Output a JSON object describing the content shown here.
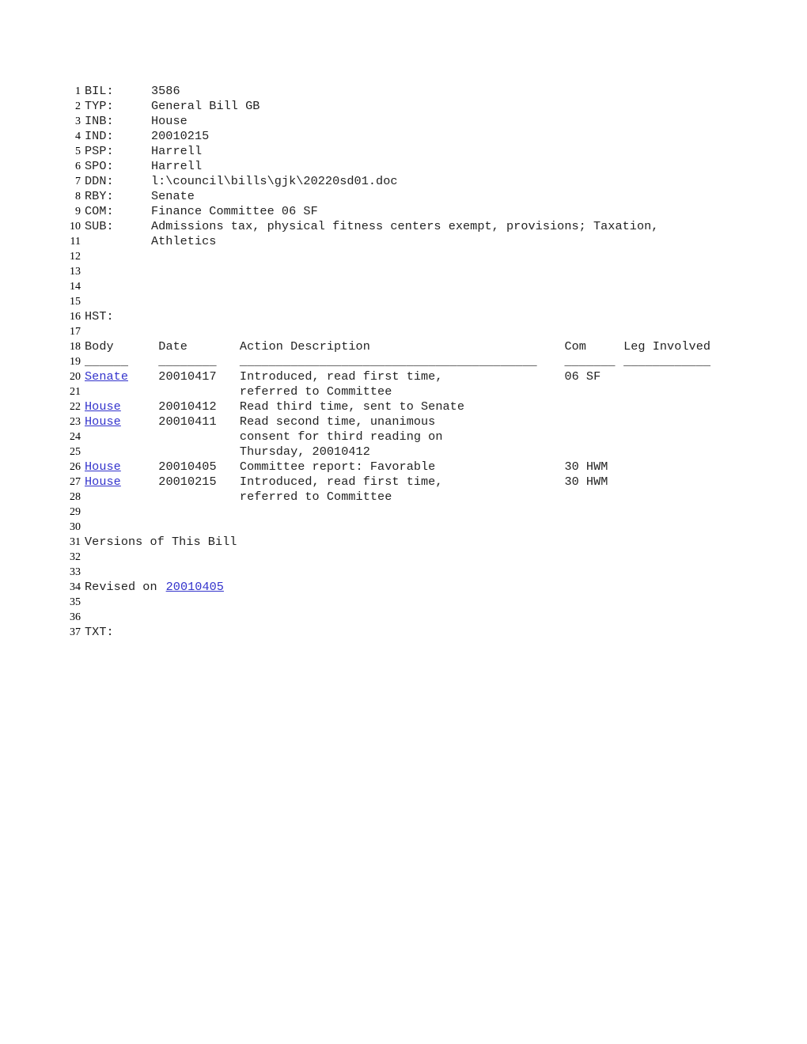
{
  "document": {
    "type": "legislative-bill-record",
    "colors": {
      "text": "#222222",
      "link": "#3333cc",
      "background": "#ffffff",
      "line_number": "#000000"
    },
    "fields": [
      {
        "label": "BIL:",
        "value": "3586"
      },
      {
        "label": "TYP:",
        "value": "General Bill GB"
      },
      {
        "label": "INB:",
        "value": "House"
      },
      {
        "label": "IND:",
        "value": "20010215"
      },
      {
        "label": "PSP:",
        "value": "Harrell"
      },
      {
        "label": "SPO:",
        "value": "Harrell"
      },
      {
        "label": "DDN:",
        "value": "l:\\council\\bills\\gjk\\20220sd01.doc"
      },
      {
        "label": "RBY:",
        "value": "Senate"
      },
      {
        "label": "COM:",
        "value": "Finance Committee 06 SF"
      },
      {
        "label": "SUB:",
        "value": "Admissions tax, physical fitness centers exempt, provisions; Taxation,"
      },
      {
        "label": "",
        "value": "Athletics"
      }
    ],
    "history": {
      "heading": "HST:",
      "columns": [
        "Body",
        "Date",
        "Action Description",
        "Com",
        "Leg Involved"
      ],
      "rules": {
        "body": "______",
        "date": "________",
        "action": "_________________________________________",
        "com": "_______",
        "leg": "____________"
      },
      "rows": [
        {
          "body": "Senate",
          "body_is_link": true,
          "date": "20010417",
          "action": "Introduced, read first time,",
          "com": "06 SF",
          "leg": ""
        },
        {
          "body": "",
          "body_is_link": false,
          "date": "",
          "action": "referred to Committee",
          "com": "",
          "leg": ""
        },
        {
          "body": "House",
          "body_is_link": true,
          "date": "20010412",
          "action": "Read third time, sent to Senate",
          "com": "",
          "leg": ""
        },
        {
          "body": "House",
          "body_is_link": true,
          "date": "20010411",
          "action": "Read second time, unanimous",
          "com": "",
          "leg": ""
        },
        {
          "body": "",
          "body_is_link": false,
          "date": "",
          "action": "consent for third reading on",
          "com": "",
          "leg": ""
        },
        {
          "body": "",
          "body_is_link": false,
          "date": "",
          "action": "Thursday, 20010412",
          "com": "",
          "leg": ""
        },
        {
          "body": "House",
          "body_is_link": true,
          "date": "20010405",
          "action": "Committee report: Favorable",
          "com": "30 HWM",
          "leg": ""
        },
        {
          "body": "House",
          "body_is_link": true,
          "date": "20010215",
          "action": "Introduced, read first time,",
          "com": "30 HWM",
          "leg": ""
        },
        {
          "body": "",
          "body_is_link": false,
          "date": "",
          "action": "referred to Committee",
          "com": "",
          "leg": ""
        }
      ]
    },
    "versions": {
      "heading": "Versions of This Bill",
      "revised_prefix": "Revised on ",
      "revised_date": "20010405"
    },
    "text_section": {
      "heading": "TXT:"
    },
    "line_numbers": [
      "1",
      "2",
      "3",
      "4",
      "5",
      "6",
      "7",
      "8",
      "9",
      "10",
      "11",
      "12",
      "13",
      "14",
      "15",
      "16",
      "17",
      "18",
      "19",
      "20",
      "21",
      "22",
      "23",
      "24",
      "25",
      "26",
      "27",
      "28",
      "29",
      "30",
      "31",
      "32",
      "33",
      "34",
      "35",
      "36",
      "37"
    ]
  }
}
